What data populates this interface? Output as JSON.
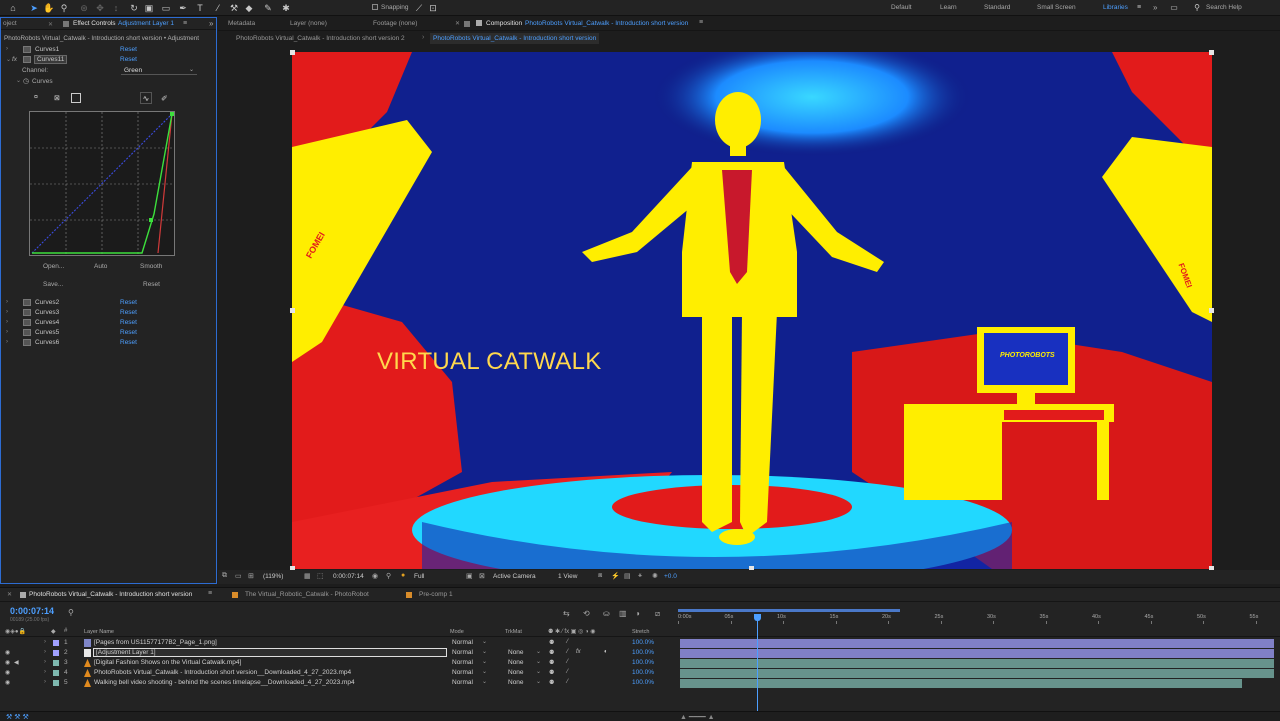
{
  "toolbar": {
    "snapping_label": "Snapping",
    "workspaces": [
      {
        "label": "Default",
        "active": false
      },
      {
        "label": "Learn",
        "active": false
      },
      {
        "label": "Standard",
        "active": false
      },
      {
        "label": "Small Screen",
        "active": false
      },
      {
        "label": "Libraries",
        "active": true
      }
    ],
    "overflow": "»",
    "search_label": "Search Help"
  },
  "left_panel": {
    "tab_project": "oject",
    "tab_effect_controls": "Effect Controls",
    "tab_effect_target": "Adjustment Layer 1",
    "breadcrumb": "PhotoRobots Virtual_Catwalk - Introduction short version • Adjustment",
    "effects_top": [
      {
        "name": "Curves1",
        "reset": "Reset"
      },
      {
        "name": "Curves11",
        "reset": "Reset"
      }
    ],
    "channel_label": "Channel:",
    "channel_value": "Green",
    "curves_label": "Curves",
    "buttons": {
      "open": "Open...",
      "auto": "Auto",
      "smooth": "Smooth",
      "save": "Save...",
      "reset": "Reset"
    },
    "effects_bottom": [
      {
        "name": "Curves2",
        "reset": "Reset"
      },
      {
        "name": "Curves3",
        "reset": "Reset"
      },
      {
        "name": "Curves4",
        "reset": "Reset"
      },
      {
        "name": "Curves5",
        "reset": "Reset"
      },
      {
        "name": "Curves6",
        "reset": "Reset"
      }
    ]
  },
  "viewer": {
    "tab_metadata": "Metadata",
    "tab_layer": "Layer (none)",
    "tab_footage": "Footage (none)",
    "tab_composition": "Composition",
    "comp_name": "PhotoRobots Virtual_Catwalk - Introduction short version",
    "breadcrumb_1": "PhotoRobots Virtual_Catwalk - Introduction short version 2",
    "breadcrumb_2": "PhotoRobots Virtual_Catwalk - Introduction short version",
    "overlay_text": "VIRTUAL CATWALK",
    "brand_left": "FOMEI",
    "brand_right": "FOMEI",
    "monitor_logo": "PHOTOROBOTS",
    "footer": {
      "zoom": "(119%)",
      "timecode": "0:00:07:14",
      "resolution": "Full",
      "camera": "Active Camera",
      "views": "1 View",
      "exposure": "+0.0"
    }
  },
  "timeline": {
    "tabs": [
      {
        "label": "PhotoRobots Virtual_Catwalk - Introduction short version",
        "active": true
      },
      {
        "label": "The Virtual_Robotic_Catwalk - PhotoRobot",
        "active": false
      },
      {
        "label": "Pre-comp 1",
        "active": false
      }
    ],
    "timecode": "0:00:07:14",
    "frame_info": "00189 (25.00 fps)",
    "columns": {
      "layer_name": "Layer Name",
      "mode": "Mode",
      "trkmat": "TrkMat",
      "stretch": "Stretch"
    },
    "ruler": [
      "0:00s",
      "05s",
      "10s",
      "15s",
      "20s",
      "25s",
      "30s",
      "35s",
      "40s",
      "45s",
      "50s",
      "55s"
    ],
    "playhead_time_s": 7.56,
    "layers": [
      {
        "num": "1",
        "name": "[Pages from US11577177B2_Page_1.png]",
        "mode": "Normal",
        "trkmat": "",
        "stretch": "100.0%",
        "type": "image",
        "label_color": "#a0a0ff",
        "selected": false
      },
      {
        "num": "2",
        "name": "[Adjustment Layer 1]",
        "mode": "Normal",
        "trkmat": "None",
        "stretch": "100.0%",
        "type": "adjustment",
        "label_color": "#a0a0ff",
        "selected": true
      },
      {
        "num": "3",
        "name": "[Digital Fashion Shows on the Virtual Catwalk.mp4]",
        "mode": "Normal",
        "trkmat": "None",
        "stretch": "100.0%",
        "type": "video",
        "label_color": "#7fb9b0",
        "selected": false
      },
      {
        "num": "4",
        "name": "PhotoRobots Virtual_Catwalk - Introduction short version__Downloaded_4_27_2023.mp4",
        "mode": "Normal",
        "trkmat": "None",
        "stretch": "100.0%",
        "type": "video",
        "label_color": "#7fb9b0",
        "selected": false
      },
      {
        "num": "5",
        "name": "Walking bell video shooting - behind the scenes timelapse__Downloaded_4_27_2023.mp4",
        "mode": "Normal",
        "trkmat": "None",
        "stretch": "100.0%",
        "type": "video",
        "label_color": "#7fb9b0",
        "selected": false
      }
    ]
  }
}
